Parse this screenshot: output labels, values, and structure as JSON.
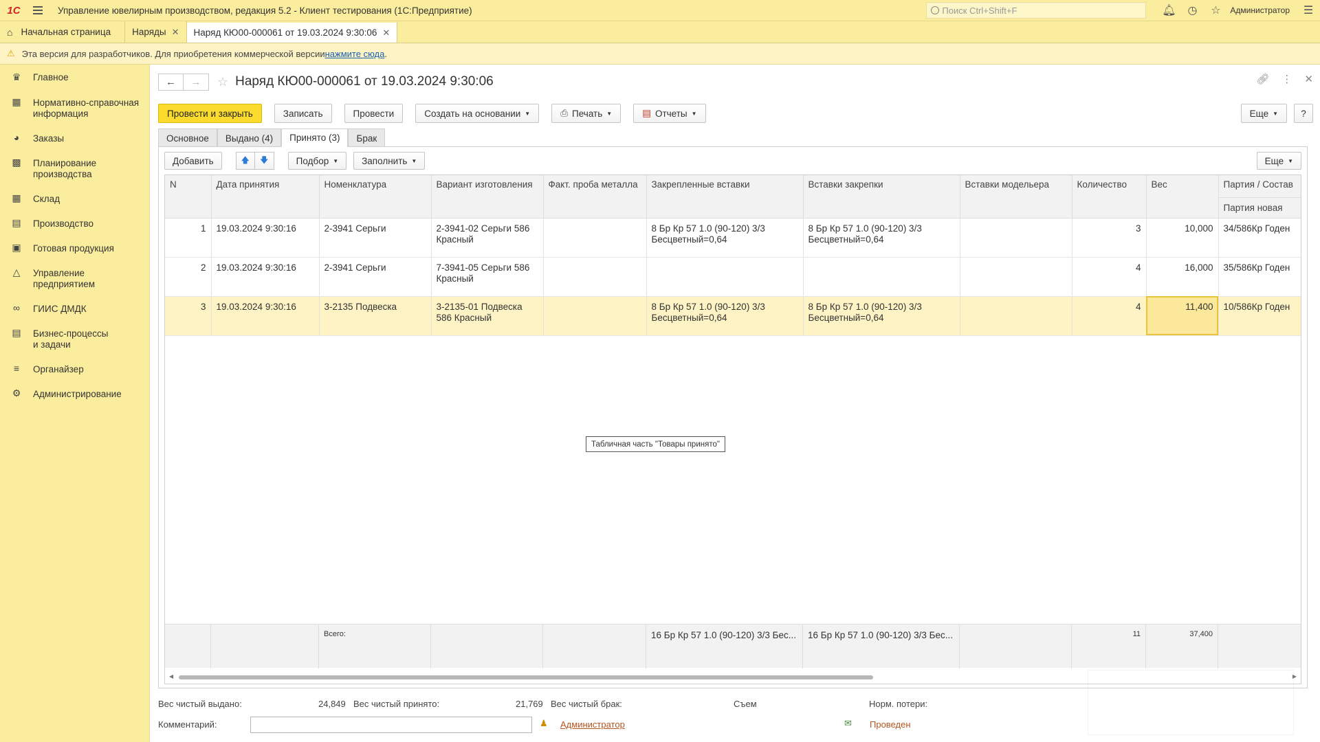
{
  "app": {
    "logo": "1С",
    "title": "Управление ювелирным производством, редакция 5.2  - Клиент тестирования (1С:Предприятие)",
    "search_placeholder": "Поиск Ctrl+Shift+F",
    "user": "Администратор"
  },
  "tabs": [
    {
      "label": "Начальная страница"
    },
    {
      "label": "Наряды"
    },
    {
      "label": "Наряд КЮ00-000061 от 19.03.2024 9:30:06"
    }
  ],
  "notice": {
    "text": "Эта версия для разработчиков. Для приобретения коммерческой версии ",
    "link": "нажмите сюда",
    "tail": "."
  },
  "sidebar": [
    {
      "label": "Главное",
      "icon": "crown-icon"
    },
    {
      "label": "Нормативно-справочная информация",
      "icon": "book-icon"
    },
    {
      "label": "Заказы",
      "icon": "pie-icon"
    },
    {
      "label": "Планирование производства",
      "icon": "calendar-icon"
    },
    {
      "label": "Склад",
      "icon": "grid-icon"
    },
    {
      "label": "Производство",
      "icon": "factory-icon"
    },
    {
      "label": "Готовая продукция",
      "icon": "box-icon"
    },
    {
      "label": "Управление предприятием",
      "icon": "chart-icon"
    },
    {
      "label": "ГИИС ДМДК",
      "icon": "link-icon"
    },
    {
      "label": "Бизнес-процессы и задачи",
      "icon": "tasks-icon"
    },
    {
      "label": "Органайзер",
      "icon": "sliders-icon"
    },
    {
      "label": "Администрирование",
      "icon": "gear-icon"
    }
  ],
  "form": {
    "title": "Наряд КЮ00-000061 от 19.03.2024 9:30:06",
    "buttons": {
      "post_close": "Провести и закрыть",
      "save": "Записать",
      "post": "Провести",
      "create_based": "Создать на основании",
      "print": "Печать",
      "reports": "Отчеты",
      "more": "Еще",
      "help": "?"
    },
    "tabs": [
      "Основное",
      "Выдано (4)",
      "Принято (3)",
      "Брак"
    ],
    "table_toolbar": {
      "add": "Добавить",
      "pick": "Подбор",
      "fill": "Заполнить",
      "more": "Еще"
    },
    "columns": [
      "N",
      "Дата принятия",
      "Номенклатура",
      "Вариант изготовления",
      "Факт. проба металла",
      "Закрепленные вставки",
      "Вставки закрепки",
      "Вставки модельера",
      "Количество",
      "Вес",
      "Партия / Состав",
      "Партия новая"
    ],
    "rows": [
      {
        "n": "1",
        "date": "19.03.2024 9:30:16",
        "nom": "2-3941 Серьги",
        "variant": "2-3941-02 Серьги 586 Красный",
        "probe": "",
        "fixed": "8 Бр Кр 57 1.0 (90-120) 3/3 Бесцветный=0,64",
        "inserts": "8 Бр Кр 57 1.0 (90-120) 3/3 Бесцветный=0,64",
        "model": "",
        "qty": "3",
        "weight": "10,000",
        "batch": "34/586Кр Годен"
      },
      {
        "n": "2",
        "date": "19.03.2024 9:30:16",
        "nom": "2-3941 Серьги",
        "variant": "7-3941-05 Серьги 586 Красный",
        "probe": "",
        "fixed": "",
        "inserts": "",
        "model": "",
        "qty": "4",
        "weight": "16,000",
        "batch": "35/586Кр Годен"
      },
      {
        "n": "3",
        "date": "19.03.2024 9:30:16",
        "nom": "3-2135 Подвеска",
        "variant": "3-2135-01 Подвеска 586 Красный",
        "probe": "",
        "fixed": "8 Бр Кр 57 1.0 (90-120) 3/3 Бесцветный=0,64",
        "inserts": "8 Бр Кр 57 1.0 (90-120) 3/3 Бесцветный=0,64",
        "model": "",
        "qty": "4",
        "weight": "11,400",
        "batch": "10/586Кр Годен"
      }
    ],
    "totals": {
      "label": "Всего:",
      "fixed": "16 Бр Кр 57 1.0 (90-120) 3/3 Бес...",
      "inserts": "16 Бр Кр 57 1.0 (90-120) 3/3 Бес...",
      "qty": "11",
      "weight": "37,400"
    },
    "tooltip": "Табличная часть \"Товары принято\"",
    "bottom": {
      "net_issued_label": "Вес чистый выдано:",
      "net_issued": "24,849",
      "net_received_label": "Вес чистый принято:",
      "net_received": "21,769",
      "net_defect_label": "Вес чистый брак:",
      "removal_label": "Съем",
      "loss_label": "Норм. потери:",
      "comment_label": "Комментарий:",
      "author": "Администратор",
      "status": "Проведен"
    }
  }
}
